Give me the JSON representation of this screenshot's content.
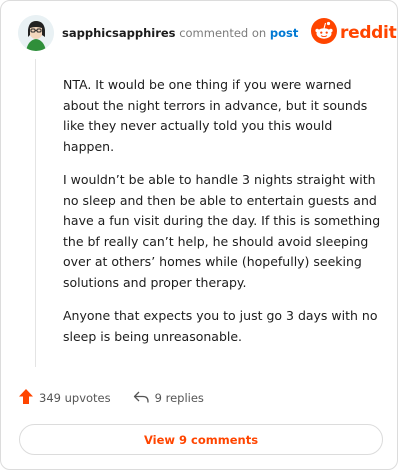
{
  "header": {
    "author": "sapphicsapphires",
    "action": "commented on",
    "post_link": "post",
    "brand": "reddit"
  },
  "comment": {
    "paragraphs": [
      "NTA. It would be one thing if you were warned about the night terrors in advance, but it sounds like they never actually told you this would happen.",
      "I wouldn’t be able to handle 3 nights straight with no sleep and then be able to entertain guests and have a fun visit during the day. If this is something the bf really can’t help, he should avoid sleeping over at others’ homes while (hopefully) seeking solutions and proper therapy.",
      "Anyone that expects you to just go 3 days with no sleep is being unreasonable."
    ]
  },
  "footer": {
    "upvotes": "349 upvotes",
    "replies": "9 replies"
  },
  "view_button": {
    "label": "View 9 comments"
  },
  "colors": {
    "brand": "#ff4500",
    "link": "#0079d3"
  },
  "icons": [
    "avatar",
    "reddit-logo-icon",
    "upvote-icon",
    "reply-icon"
  ]
}
